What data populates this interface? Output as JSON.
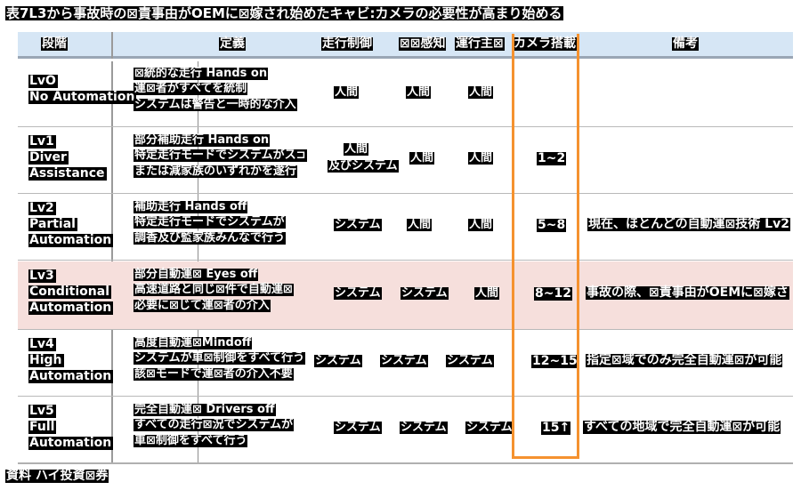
{
  "title": "表7L3から事故時の⊠責事由がOEMに⊠嫁され始めたキャビ:カメラの必要性が高まり始める",
  "colors": {
    "header_bg": "#d6e6f5",
    "highlight_row_bg": "#f6dfdc",
    "accent_box": "#f5922f",
    "text_highlight_bg": "#000000",
    "text_highlight_fg": "#ffffff"
  },
  "table": {
    "headers": [
      {
        "label": "段階"
      },
      {
        "label": "定義"
      },
      {
        "label": "走行制御"
      },
      {
        "label": "⊠⊠感知"
      },
      {
        "label": "運行主⊠"
      },
      {
        "label": "カメラ搭載"
      },
      {
        "label": "備考"
      }
    ],
    "rows": [
      {
        "stage": [
          "LvO",
          "No Automation"
        ],
        "definition": [
          "⊠統的な走行 Hands on",
          "運⊠者がすべてを統制",
          "システムは警告と一時的な介入"
        ],
        "control": "人間",
        "sense": "人間",
        "operator": "人間",
        "camera": "",
        "remarks": "",
        "highlight": false
      },
      {
        "stage": [
          "Lv1",
          "Diver",
          "Assistance"
        ],
        "definition": [
          "部分補助走行 Hands on",
          "特定走行モードでシステムがス⊐",
          "または減家族のいずれかを遂行"
        ],
        "control": "人間",
        "control_overlap": [
          "人間",
          "及びシステム"
        ],
        "sense": "人間",
        "operator": "人間",
        "camera": "1~2",
        "remarks": "",
        "highlight": false
      },
      {
        "stage": [
          "Lv2",
          "Partial",
          "Automation"
        ],
        "definition": [
          "補助走行 Hands off",
          "特定走行モードでシステムが",
          "調香及び監家族みんなで行う"
        ],
        "control": "システム",
        "sense": "人間",
        "operator": "人間",
        "camera": "5~8",
        "remarks": "現在、ほとんどの自動運⊠技術 Lv2",
        "highlight": false
      },
      {
        "stage": [
          "Lv3",
          "Conditional",
          "Automation"
        ],
        "definition": [
          "部分自動運⊠ Eyes off",
          "高速道路と同じ⊠件で自動運⊠",
          "必要に⊠じて運⊠者の介入"
        ],
        "control": "システム",
        "sense": "システム",
        "operator": "人間",
        "camera": "8~12",
        "remarks": "事故の際、⊠責事由がOEMに⊠嫁さ",
        "highlight": true
      },
      {
        "stage": [
          "Lv4",
          "High",
          "Automation"
        ],
        "definition": [
          "高度自動運⊠Mindoff",
          "システムが車⊠制御をすべて行う",
          "該⊠モードで運⊠者の介入不要"
        ],
        "control": "システム",
        "sense": "システム",
        "operator": "システム",
        "camera": "12~15",
        "remarks": "指定⊠域でのみ完全自動運⊠が可能",
        "highlight": false
      },
      {
        "stage": [
          "Lv5",
          "Full",
          "Automation"
        ],
        "definition": [
          "完全自動運⊠ Drivers off",
          "すべての走行⊠況でシステムが",
          "車⊠制御をすべて行う"
        ],
        "control": "システム",
        "sense": "システム",
        "operator": "システム",
        "camera": "15↑",
        "remarks": "すべての地域で完全自動運⊠が可能",
        "highlight": false
      }
    ]
  },
  "footer": {
    "source": "資料 ハイ投資⊠券"
  }
}
